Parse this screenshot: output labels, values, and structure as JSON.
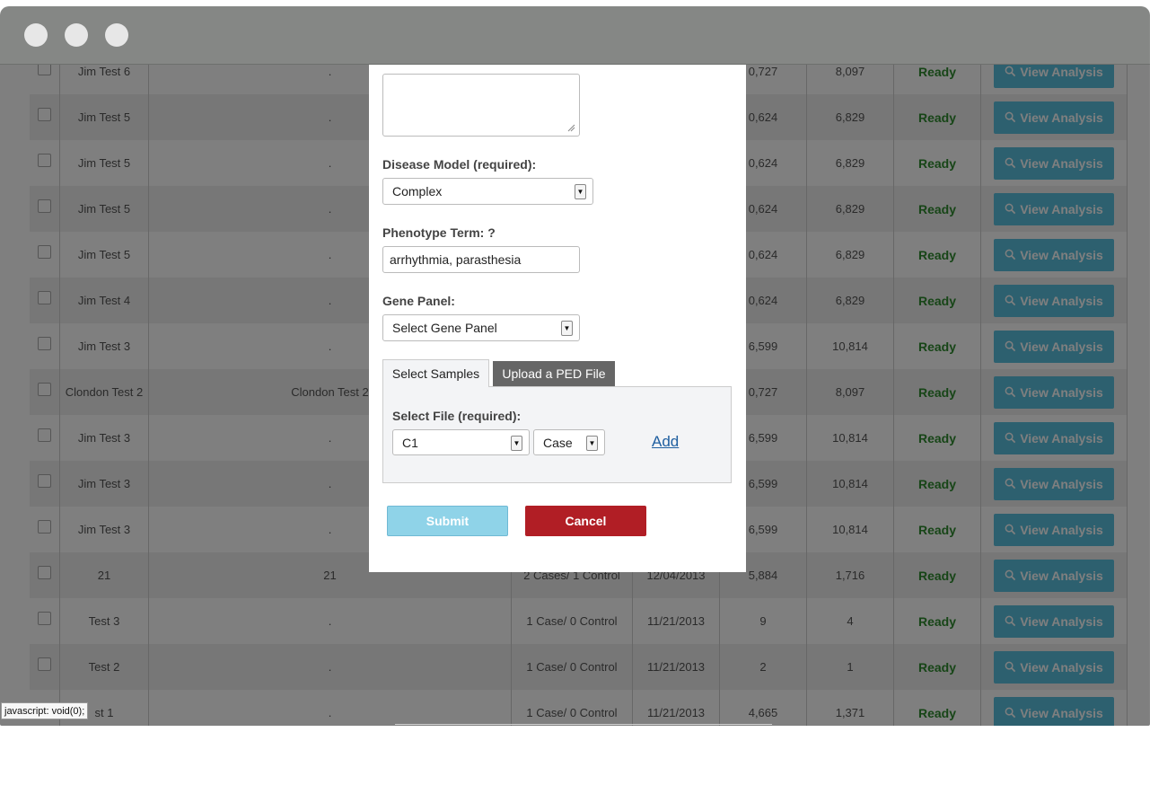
{
  "window": {
    "dot_colors": [
      "#e7e7e7",
      "#e7e7e7",
      "#e7e7e7"
    ]
  },
  "table": {
    "rows": [
      {
        "name": "Jim Test 6",
        "desc": ".",
        "samples": "",
        "date": "",
        "variants": "0,727",
        "genes": "8,097",
        "status": "Ready",
        "action": "View Analysis"
      },
      {
        "name": "Jim Test 5",
        "desc": ".",
        "samples": "",
        "date": "",
        "variants": "0,624",
        "genes": "6,829",
        "status": "Ready",
        "action": "View Analysis"
      },
      {
        "name": "Jim Test 5",
        "desc": ".",
        "samples": "",
        "date": "",
        "variants": "0,624",
        "genes": "6,829",
        "status": "Ready",
        "action": "View Analysis"
      },
      {
        "name": "Jim Test 5",
        "desc": ".",
        "samples": "",
        "date": "",
        "variants": "0,624",
        "genes": "6,829",
        "status": "Ready",
        "action": "View Analysis"
      },
      {
        "name": "Jim Test 5",
        "desc": ".",
        "samples": "",
        "date": "",
        "variants": "0,624",
        "genes": "6,829",
        "status": "Ready",
        "action": "View Analysis"
      },
      {
        "name": "Jim Test 4",
        "desc": ".",
        "samples": "",
        "date": "",
        "variants": "0,624",
        "genes": "6,829",
        "status": "Ready",
        "action": "View Analysis"
      },
      {
        "name": "Jim Test 3",
        "desc": ".",
        "samples": "",
        "date": "",
        "variants": "6,599",
        "genes": "10,814",
        "status": "Ready",
        "action": "View Analysis"
      },
      {
        "name": "Clondon Test 2",
        "desc": "Clondon Test 2",
        "samples": "",
        "date": "",
        "variants": "0,727",
        "genes": "8,097",
        "status": "Ready",
        "action": "View Analysis"
      },
      {
        "name": "Jim Test 3",
        "desc": ".",
        "samples": "",
        "date": "",
        "variants": "6,599",
        "genes": "10,814",
        "status": "Ready",
        "action": "View Analysis"
      },
      {
        "name": "Jim Test 3",
        "desc": ".",
        "samples": "",
        "date": "",
        "variants": "6,599",
        "genes": "10,814",
        "status": "Ready",
        "action": "View Analysis"
      },
      {
        "name": "Jim Test 3",
        "desc": ".",
        "samples": "",
        "date": "",
        "variants": "6,599",
        "genes": "10,814",
        "status": "Ready",
        "action": "View Analysis"
      },
      {
        "name": "21",
        "desc": "21",
        "samples": "2 Cases/ 1 Control",
        "date": "12/04/2013",
        "variants": "5,884",
        "genes": "1,716",
        "status": "Ready",
        "action": "View Analysis"
      },
      {
        "name": "Test 3",
        "desc": ".",
        "samples": "1 Case/ 0 Control",
        "date": "11/21/2013",
        "variants": "9",
        "genes": "4",
        "status": "Ready",
        "action": "View Analysis"
      },
      {
        "name": "Test 2",
        "desc": ".",
        "samples": "1 Case/ 0 Control",
        "date": "11/21/2013",
        "variants": "2",
        "genes": "1",
        "status": "Ready",
        "action": "View Analysis"
      },
      {
        "name": "st 1",
        "desc": ".",
        "samples": "1 Case/ 0 Control",
        "date": "11/21/2013",
        "variants": "4,665",
        "genes": "1,371",
        "status": "Ready",
        "action": "View Analysis"
      }
    ]
  },
  "modal": {
    "description_value": "",
    "disease_model_label": "Disease Model (required):",
    "disease_model_value": "Complex",
    "phenotype_label": "Phenotype Term: ?",
    "phenotype_value": "arrhythmia, parasthesia",
    "gene_panel_label": "Gene Panel:",
    "gene_panel_value": "Select Gene Panel",
    "tabs": [
      "Select Samples",
      "Upload a PED File"
    ],
    "select_file_label": "Select File (required):",
    "file_value": "C1",
    "case_value": "Case",
    "add_label": "Add",
    "submit_label": "Submit",
    "cancel_label": "Cancel"
  },
  "colors": {
    "submit": "#5bc0de",
    "cancel": "#c9302c",
    "ready": "#2e8b2e",
    "link": "#1f6fb2"
  },
  "statusbar": "javascript: void(0);"
}
